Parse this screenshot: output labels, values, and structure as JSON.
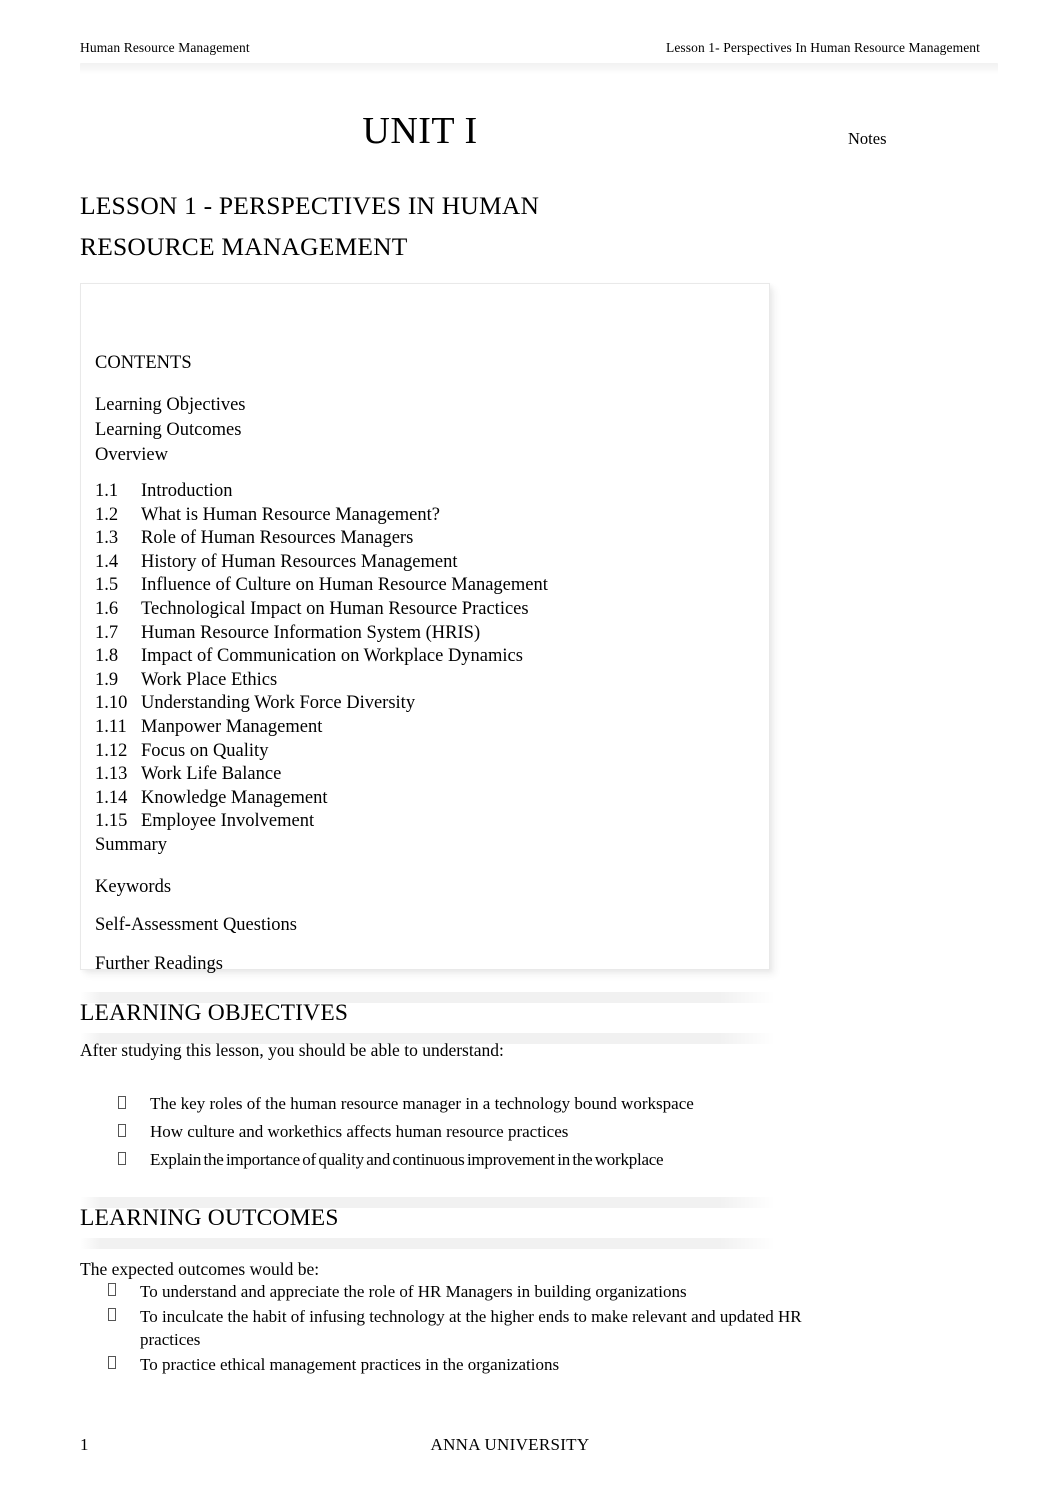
{
  "header": {
    "left": "Human Resource Management",
    "right": "Lesson 1- Perspectives In Human Resource Management"
  },
  "title": {
    "unit": "UNIT I",
    "notes_label": "Notes",
    "lesson_line1": "LESSON 1 - PERSPECTIVES IN HUMAN",
    "lesson_line2": "RESOURCE MANAGEMENT"
  },
  "contents": {
    "heading": "CONTENTS",
    "front_matter": [
      "Learning Objectives",
      "Learning Outcomes",
      "Overview"
    ],
    "entries": [
      {
        "num": "1.1",
        "label": "Introduction"
      },
      {
        "num": "1.2",
        "label": "What is Human Resource Management?"
      },
      {
        "num": "1.3",
        "label": "Role of Human Resources Managers"
      },
      {
        "num": "1.4",
        "label": "History of Human Resources Management"
      },
      {
        "num": "1.5",
        "label": "Influence of Culture on Human Resource Management"
      },
      {
        "num": "1.6",
        "label": "Technological Impact on Human Resource Practices"
      },
      {
        "num": "1.7",
        "label": "Human Resource Information System (HRIS)"
      },
      {
        "num": "1.8",
        "label": "Impact of Communication on Workplace Dynamics"
      },
      {
        "num": "1.9",
        "label": "Work Place Ethics"
      },
      {
        "num": "1.10",
        "label": "Understanding  Work  Force  Diversity"
      },
      {
        "num": "1.11",
        "label": "Manpower  Management"
      },
      {
        "num": "1.12",
        "label": "Focus  on  Quality"
      },
      {
        "num": "1.13",
        "label": "Work  Life  Balance"
      },
      {
        "num": "1.14",
        "label": "Knowledge  Management"
      },
      {
        "num": "1.15",
        "label": "Employee  Involvement"
      }
    ],
    "summary": "Summary",
    "tail": [
      "Keywords",
      "Self-Assessment Questions",
      "Further Readings"
    ]
  },
  "learning_objectives": {
    "heading": "LEARNING OBJECTIVES",
    "intro": "After studying this lesson, you should be able to understand:",
    "bullet_glyph": "missing-glyph-box",
    "items": [
      "The key roles of the human resource manager in a technology bound workspace",
      "How culture and workethics affects human resource practices",
      "Explain the importance of quality and continuous improvement in the workplace"
    ]
  },
  "learning_outcomes": {
    "heading": "LEARNING OUTCOMES",
    "intro": "The expected outcomes would be:",
    "bullet_glyph": "missing-glyph-box",
    "items": [
      "To understand and appreciate the role of HR Managers in building organizations",
      "To inculcate the habit of infusing technology at the higher ends to make relevant and updated HR practices",
      "To practice ethical management practices in the organizations"
    ]
  },
  "footer": {
    "page_number": "1",
    "university": "ANNA UNIVERSITY"
  }
}
